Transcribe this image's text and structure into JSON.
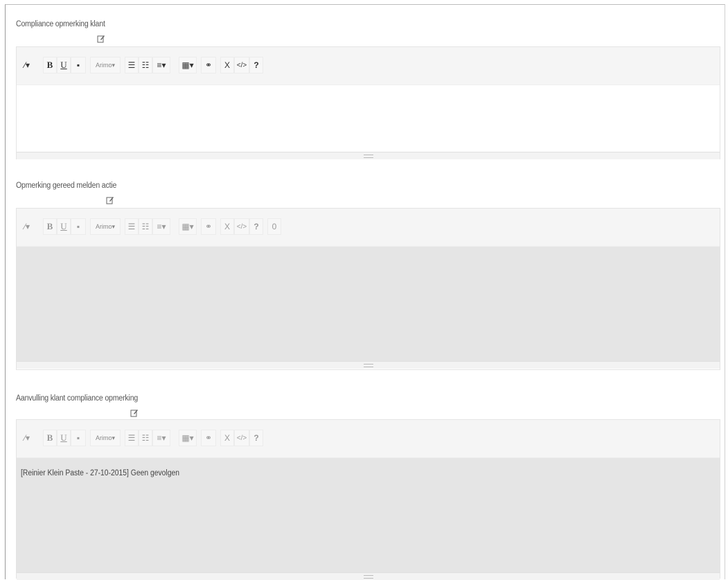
{
  "sections": [
    {
      "label": "Compliance opmerking klant",
      "content": "",
      "toolbar": {
        "style": "⁄",
        "bold": "B",
        "underline": "U",
        "eraser": "▪",
        "font": "Arimo▾",
        "ul": "☰",
        "ol": "☷",
        "align": "≡▾",
        "table": "▦▾",
        "link": "⚭",
        "fullscreen": "X",
        "code": "</>",
        "help": "?"
      }
    },
    {
      "label": "Opmerking gereed melden actie",
      "content": "",
      "toolbar": {
        "style": "⁄",
        "bold": "B",
        "underline": "U",
        "eraser": "▪",
        "font": "Arimo▾",
        "ul": "☰",
        "ol": "☷",
        "align": "≡▾",
        "table": "▦▾",
        "link": "⚭",
        "fullscreen": "X",
        "code": "</>",
        "help": "?",
        "extra": "0"
      }
    },
    {
      "label": "Aanvulling klant compliance opmerking",
      "content": "[Reinier Klein Paste - 27-10-2015] Geen gevolgen",
      "toolbar": {
        "style": "⁄",
        "bold": "B",
        "underline": "U",
        "eraser": "▪",
        "font": "Arimo▾",
        "ul": "☰",
        "ol": "☷",
        "align": "≡▾",
        "table": "▦▾",
        "link": "⚭",
        "fullscreen": "X",
        "code": "</>",
        "help": "?"
      }
    }
  ]
}
